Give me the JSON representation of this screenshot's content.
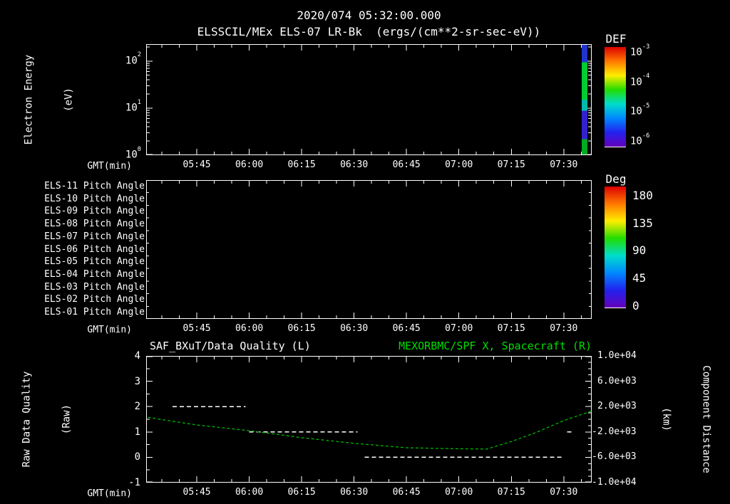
{
  "header": {
    "timestamp": "2020/074 05:32:00.000",
    "title": "ELSSCIL/MEx ELS-07 LR-Bk  (ergs/(cm**2-sr-sec-eV))"
  },
  "colors": {
    "background": "#000000",
    "foreground": "#ffffff",
    "green_text": "#00dd00",
    "green_curve": "#00b400",
    "quality_line": "#ffffff"
  },
  "time_axis": {
    "label": "GMT(min)",
    "start_min": 330.5,
    "end_min": 458,
    "major_ticks": [
      "05:45",
      "06:00",
      "06:15",
      "06:30",
      "06:45",
      "07:00",
      "07:15",
      "07:30"
    ],
    "minor_step_min": 5
  },
  "chart_data": [
    {
      "type": "heatmap",
      "title": "ELSSCIL/MEx ELS-07 LR-Bk (ergs/(cm**2-sr-sec-eV))",
      "xlabel": "GMT(min)",
      "ylabel": "Electron Energy (eV)",
      "ylabel_lines": [
        "Electron Energy",
        "(eV)"
      ],
      "y_scale": "log",
      "y_range_exp": [
        0,
        2.36
      ],
      "y_ticks": [
        {
          "base": "10",
          "exp": "2"
        },
        {
          "base": "10",
          "exp": "1"
        },
        {
          "base": "10",
          "exp": "0"
        }
      ],
      "colorbar": {
        "title": "DEF",
        "gradient": [
          "#dd0000",
          "#ff7700",
          "#ffee00",
          "#22dd00",
          "#00ddcc",
          "#0088ff",
          "#2222ee",
          "#6600bb"
        ],
        "ticks": [
          {
            "base": "10",
            "exp": "-3",
            "frac": 0.064
          },
          {
            "base": "10",
            "exp": "-4",
            "frac": 0.362
          },
          {
            "base": "10",
            "exp": "-5",
            "frac": 0.66
          },
          {
            "base": "10",
            "exp": "-6",
            "frac": 0.957
          }
        ]
      },
      "data_columns": [
        {
          "time": "07:36",
          "note": "narrow burst of electron flux at right edge of panel",
          "segments": [
            {
              "f0": 0.0,
              "f1": 0.16,
              "color": "#2233cc"
            },
            {
              "f0": 0.16,
              "f1": 0.5,
              "color": "#00cc33"
            },
            {
              "f0": 0.5,
              "f1": 0.6,
              "color": "#00bbaa"
            },
            {
              "f0": 0.6,
              "f1": 0.86,
              "color": "#3322cc"
            },
            {
              "f0": 0.86,
              "f1": 1.0,
              "color": "#00aa22"
            }
          ]
        }
      ]
    },
    {
      "type": "heatmap",
      "xlabel": "GMT(min)",
      "rows": [
        "ELS-11 Pitch Angle",
        "ELS-10 Pitch Angle",
        "ELS-09 Pitch Angle",
        "ELS-08 Pitch Angle",
        "ELS-07 Pitch Angle",
        "ELS-06 Pitch Angle",
        "ELS-05 Pitch Angle",
        "ELS-04 Pitch Angle",
        "ELS-03 Pitch Angle",
        "ELS-02 Pitch Angle",
        "ELS-01 Pitch Angle"
      ],
      "values": [],
      "colorbar": {
        "title": "Deg",
        "gradient": [
          "#dd0000",
          "#ff7700",
          "#ffee00",
          "#22dd00",
          "#00ddcc",
          "#0088ff",
          "#2222ee",
          "#6600bb"
        ],
        "ticks": [
          {
            "label": "180",
            "frac": 0.076
          },
          {
            "label": "135",
            "frac": 0.304
          },
          {
            "label": "90",
            "frac": 0.532
          },
          {
            "label": "45",
            "frac": 0.76
          },
          {
            "label": "0",
            "frac": 0.988
          }
        ]
      }
    },
    {
      "type": "line",
      "title_left": "SAF_BXuT/Data Quality (L)",
      "title_right": "MEXORBMC/SPF X, Spacecraft (R)",
      "xlabel": "GMT(min)",
      "ylabel_lines": [
        "Raw Data Quality",
        "(Raw)"
      ],
      "y2label_lines": [
        "Component Distance",
        "(km)"
      ],
      "y_range": [
        -1,
        4
      ],
      "y_ticks": [
        4,
        3,
        2,
        1,
        0,
        -1
      ],
      "y2_range": [
        -10000,
        10000
      ],
      "y2_ticks": [
        "1.0e+04",
        "6.0e+03",
        "2.0e+03",
        "-2.0e+03",
        "-6.0e+03",
        "-1.0e+04"
      ],
      "series": [
        {
          "name": "SAF_BXuT/Data Quality",
          "axis": "left",
          "color": "#ffffff",
          "style": "dashed",
          "segments": [
            {
              "start": "05:38",
              "end": "05:59",
              "value": 2
            },
            {
              "start": "06:00",
              "end": "06:31",
              "value": 1
            },
            {
              "start": "06:33",
              "end": "07:30",
              "value": 0
            },
            {
              "start": "07:31",
              "end": "07:33",
              "value": 1
            }
          ]
        },
        {
          "name": "MEXORBMC/SPF X Spacecraft",
          "axis": "right",
          "color": "#00b400",
          "style": "dashed",
          "points": [
            [
              "05:31",
              300
            ],
            [
              "05:45",
              -900
            ],
            [
              "06:00",
              -1800
            ],
            [
              "06:15",
              -2900
            ],
            [
              "06:30",
              -3800
            ],
            [
              "06:45",
              -4500
            ],
            [
              "07:00",
              -4650
            ],
            [
              "07:08",
              -4700
            ],
            [
              "07:15",
              -3500
            ],
            [
              "07:22",
              -2100
            ],
            [
              "07:30",
              -200
            ],
            [
              "07:38",
              1300
            ]
          ]
        }
      ]
    }
  ]
}
